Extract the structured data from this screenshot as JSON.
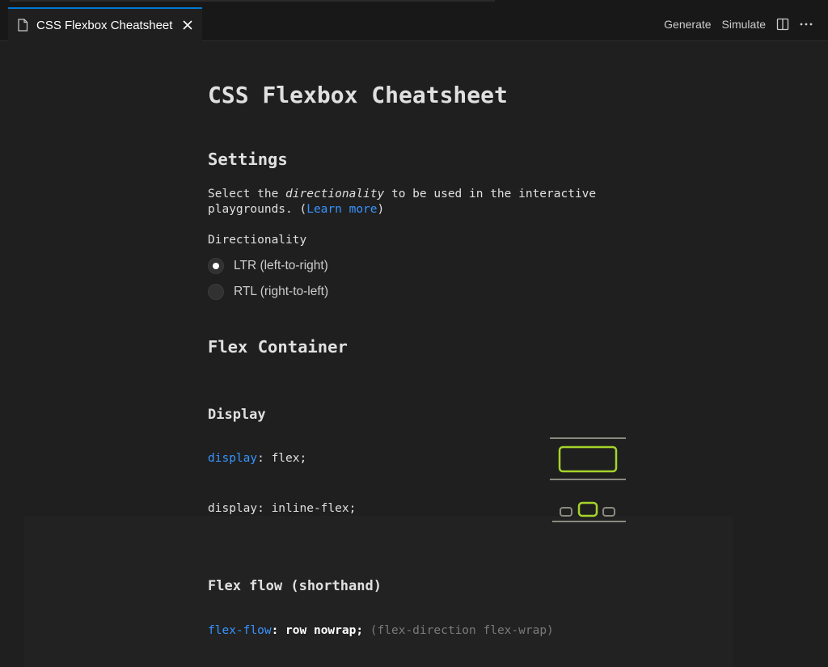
{
  "tab": {
    "title": "CSS Flexbox Cheatsheet",
    "icon": "file-icon"
  },
  "actions": {
    "generate": "Generate",
    "simulate": "Simulate"
  },
  "doc": {
    "title": "CSS Flexbox Cheatsheet",
    "settings": {
      "heading": "Settings",
      "text_before": "Select the ",
      "text_emph": "directionality",
      "text_after": " to be used in the interactive playgrounds. (",
      "link": "Learn more",
      "text_close": ")",
      "directionality_label": "Directionality",
      "options": [
        {
          "label": "LTR (left-to-right)",
          "selected": true
        },
        {
          "label": "RTL (right-to-left)",
          "selected": false
        }
      ]
    },
    "flex_container": {
      "heading": "Flex Container",
      "display": {
        "heading": "Display",
        "flex_prop": "display",
        "flex_sep": ":",
        "flex_value": " flex;",
        "inline_flex": "display: inline-flex;"
      },
      "flex_flow": {
        "heading": "Flex flow (shorthand)",
        "prop": "flex-flow",
        "sep": ":",
        "value": " row nowrap;",
        "comment": " (flex-direction flex-wrap)"
      }
    }
  },
  "colors": {
    "accent": "#3794ff",
    "diagram_green": "#a6d32a",
    "diagram_gray": "#8a8a80",
    "tab_border": "#0078d4"
  }
}
